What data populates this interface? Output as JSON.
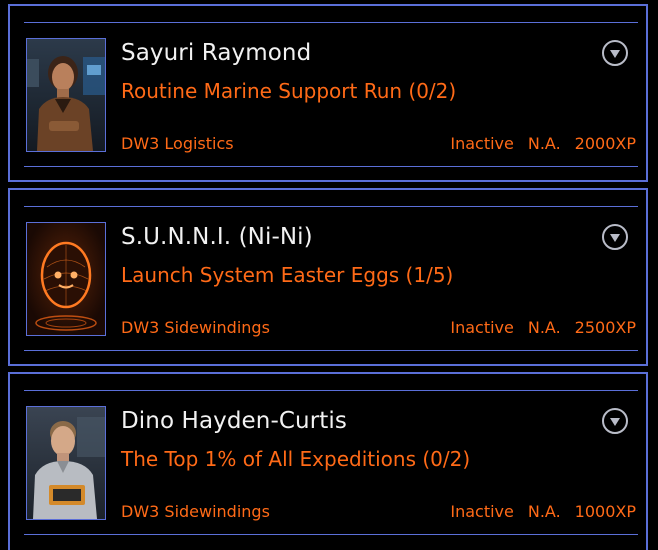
{
  "colors": {
    "border": "#5b6fd8",
    "accent": "#ff6a17",
    "name_text": "#f2f2f2",
    "background": "#000000"
  },
  "cards": [
    {
      "name": "Sayuri Raymond",
      "mission": "Routine Marine Support Run (0/2)",
      "organization": "DW3 Logistics",
      "status": "Inactive",
      "availability": "N.A.",
      "xp": "2000XP",
      "toggle_icon": "chevron-down-circle-icon"
    },
    {
      "name": "S.U.N.N.I.  (Ni-Ni)",
      "mission": "Launch System Easter Eggs (1/5)",
      "organization": "DW3 Sidewindings",
      "status": "Inactive",
      "availability": "N.A.",
      "xp": "2500XP",
      "toggle_icon": "chevron-down-circle-icon"
    },
    {
      "name": "Dino Hayden-Curtis",
      "mission": "The Top 1% of All Expeditions (0/2)",
      "organization": "DW3 Sidewindings",
      "status": "Inactive",
      "availability": "N.A.",
      "xp": "1000XP",
      "toggle_icon": "chevron-down-circle-icon"
    }
  ]
}
